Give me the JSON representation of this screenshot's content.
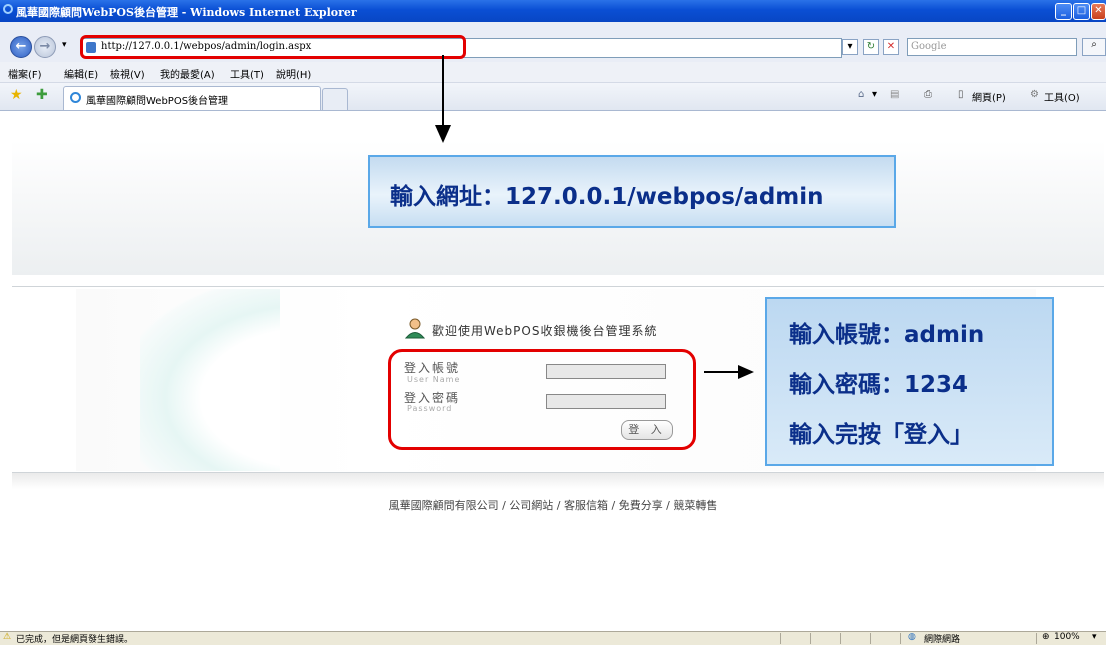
{
  "window": {
    "title": "風華國際顧問WebPOS後台管理 - Windows Internet Explorer"
  },
  "address_bar": {
    "url": "http://127.0.0.1/webpos/admin/login.aspx",
    "search_placeholder": "Google"
  },
  "menu": {
    "items": [
      "檔案(F)",
      "編輯(E)",
      "檢視(V)",
      "我的最愛(A)",
      "工具(T)",
      "說明(H)"
    ]
  },
  "favorites_bar": {
    "tab_title": "風華國際顧問WebPOS後台管理",
    "right_home": "▾",
    "right_page": "網頁(P)",
    "right_tools": "工具(O)"
  },
  "login": {
    "welcome": "歡迎使用WebPOS收銀機後台管理系統",
    "username_label": "登入帳號",
    "username_sub": "User Name",
    "password_label": "登入密碼",
    "password_sub": "Password",
    "login_button": "登 入"
  },
  "footer": {
    "links": "風華國際顧問有限公司 / 公司網站 / 客服信箱 / 免費分享 / 競菜轉售"
  },
  "annotations": {
    "url_note": "輸入網址：127.0.0.1/webpos/admin",
    "account_note": "輸入帳號：admin",
    "password_note": "輸入密碼：1234",
    "finish_note": "輸入完按「登入」"
  },
  "status_bar": {
    "message": "已完成，但是網頁發生錯誤。",
    "zone": "網際網路",
    "zoom": "100%"
  },
  "colors": {
    "highlight_red": "#e30000",
    "annotation_text": "#0b2f8a",
    "titlebar_blue": "#0a4fd4"
  }
}
